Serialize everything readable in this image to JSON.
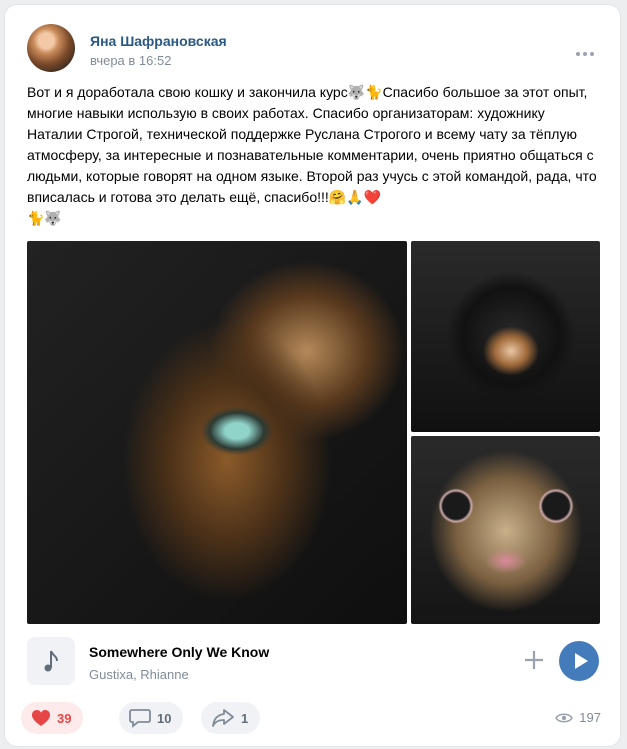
{
  "post": {
    "author": "Яна Шафрановская",
    "time": "вчера в 16:52",
    "text": "Вот и я доработала свою кошку и закончила курс🐺🐈Спасибо большое за этот опыт, многие навыки использую в своих работах. Спасибо организаторам: художнику Наталии Строгой, технической поддержке Руслана Строгого и всему чату за тёплую атмосферу, за интересные и познавательные комментарии, очень приятно общаться с людьми, которые говорят на одном языке. Второй раз учусь с этой командой, рада, что вписалась и готова это делать ещё, спасибо!!!🤗🙏❤️\n🐈🐺"
  },
  "icons": {
    "more": "more-horizontal-icon",
    "music": "music-note-icon",
    "add": "plus-icon",
    "play": "play-icon",
    "like": "heart-icon",
    "comment": "comment-icon",
    "share": "share-icon",
    "views": "eye-icon"
  },
  "audio": {
    "title": "Somewhere Only We Know",
    "artist": "Gustixa, Rhianne"
  },
  "actions": {
    "likes": "39",
    "comments": "10",
    "shares": "1",
    "views": "197"
  },
  "colors": {
    "link": "#2a5885",
    "accent": "#447bba",
    "like": "#e64646"
  }
}
